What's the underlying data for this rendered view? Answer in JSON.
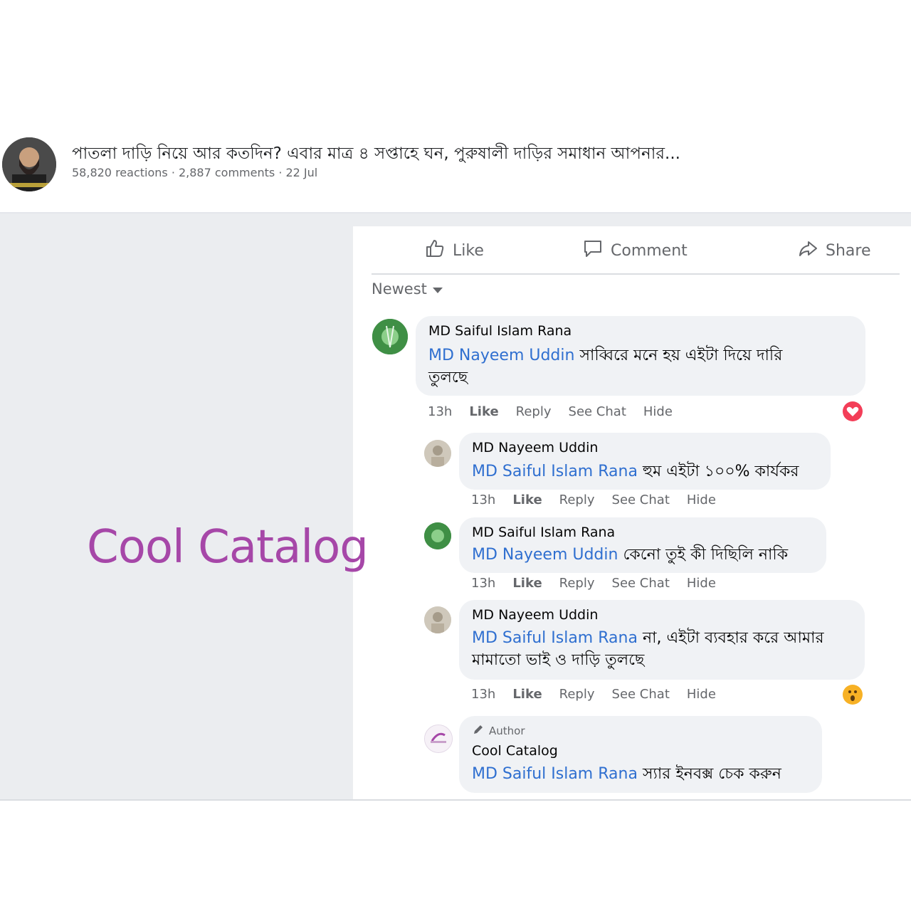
{
  "post": {
    "title": "পাতলা দাড়ি নিয়ে আর কতদিন? এবার মাত্র ৪ সপ্তাহে ঘন, পুরুষালী দাড়ির সমাধান আপনার...",
    "meta": "58,820 reactions · 2,887 comments · 22 Jul"
  },
  "watermark": "Cool Catalog",
  "actions": {
    "like": "Like",
    "comment": "Comment",
    "share": "Share"
  },
  "sort": {
    "label": "Newest"
  },
  "comments": [
    {
      "author": "MD Saiful Islam Rana",
      "mention": "MD Nayeem Uddin",
      "text_line1": " সাব্বিরে মনে হয় এইটা দিয়ে দারি",
      "text_line2": "তুলছে",
      "time": "13h",
      "like": "Like",
      "reply": "Reply",
      "see_chat": "See Chat",
      "hide": "Hide",
      "reaction": "love-reaction"
    },
    {
      "author": "MD Nayeem Uddin",
      "mention": "MD Saiful Islam Rana",
      "text_line1": " হুম এইটা ১০০% কার্যকর",
      "time": "13h",
      "like": "Like",
      "reply": "Reply",
      "see_chat": "See Chat",
      "hide": "Hide"
    },
    {
      "author": "MD Saiful Islam Rana",
      "mention": "MD Nayeem Uddin",
      "text_line1": " কেনো তুই কী দিছিলি নাকি",
      "time": "13h",
      "like": "Like",
      "reply": "Reply",
      "see_chat": "See Chat",
      "hide": "Hide"
    },
    {
      "author": "MD Nayeem Uddin",
      "mention": "MD Saiful Islam Rana",
      "text_line1": " না, এইটা ব্যবহার করে আমার",
      "text_line2": "মামাতো ভাই ও দাড়ি তুলছে",
      "time": "13h",
      "like": "Like",
      "reply": "Reply",
      "see_chat": "See Chat",
      "hide": "Hide",
      "reaction": "wow-reaction"
    },
    {
      "badge": "Author",
      "author": "Cool Catalog",
      "mention": "MD Saiful Islam Rana",
      "text_line1": " স্যার ইনবক্স চেক করুন"
    }
  ],
  "colors": {
    "mention": "#2f6fd0",
    "watermark": "#a647a8",
    "love": "#f33e58",
    "wow": "#f7b125"
  }
}
